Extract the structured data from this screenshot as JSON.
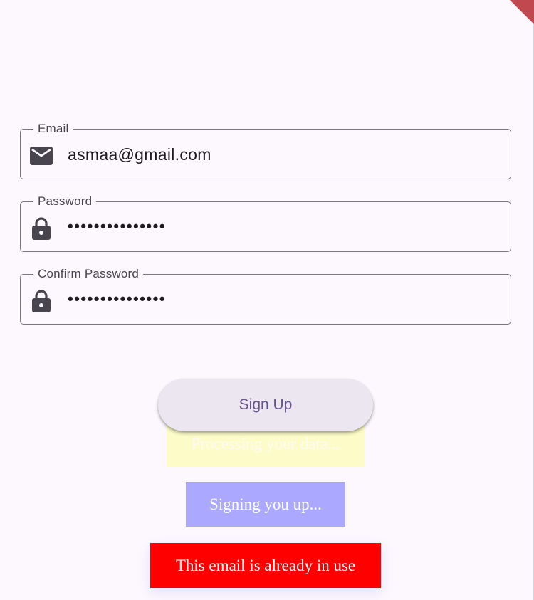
{
  "form": {
    "email": {
      "label": "Email",
      "value": "asmaa@gmail.com",
      "icon": "mail-icon"
    },
    "password": {
      "label": "Password",
      "value": "•••••••••••••••",
      "icon": "lock-icon"
    },
    "confirm_password": {
      "label": "Confirm Password",
      "value": "•••••••••••••••",
      "icon": "lock-icon"
    }
  },
  "actions": {
    "signup_label": "Sign Up"
  },
  "toasts": {
    "processing": "Processing your data...",
    "signing_up": "Signing you up...",
    "error": "This email is already in use"
  },
  "colors": {
    "background": "#fdf7fe",
    "outline": "#79747e",
    "label": "#49454f",
    "button_bg": "#ebe6f0",
    "button_text": "#65558f",
    "processing_bg": "#fdfcc8",
    "signing_bg": "#aaa8ff",
    "error_bg": "#ff0000"
  }
}
